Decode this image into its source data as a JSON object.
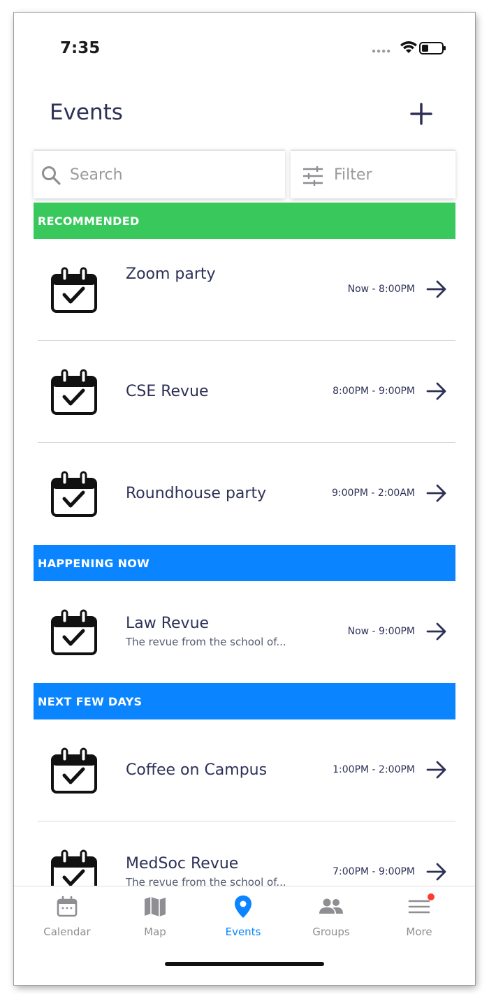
{
  "status_bar": {
    "time": "7:35"
  },
  "header": {
    "title": "Events"
  },
  "search": {
    "placeholder": "Search"
  },
  "filter": {
    "label": "Filter"
  },
  "sections": {
    "recommended": "RECOMMENDED",
    "happening_now": "HAPPENING NOW",
    "next_few_days": "NEXT FEW DAYS"
  },
  "events": {
    "zoom_party": {
      "title": "Zoom party",
      "time": "Now - 8:00PM"
    },
    "cse_revue": {
      "title": "CSE Revue",
      "time": "8:00PM - 9:00PM"
    },
    "roundhouse_party": {
      "title": "Roundhouse party",
      "time": "9:00PM - 2:00AM"
    },
    "law_revue": {
      "title": "Law Revue",
      "subtitle": "The revue from the school of...",
      "time": "Now - 9:00PM"
    },
    "coffee_on_campus": {
      "title": "Coffee on Campus",
      "time": "1:00PM - 2:00PM"
    },
    "medsoc_revue": {
      "title": "MedSoc Revue",
      "subtitle": "The revue from the school of...",
      "time": "7:00PM - 9:00PM"
    }
  },
  "tabs": {
    "calendar": "Calendar",
    "map": "Map",
    "events": "Events",
    "groups": "Groups",
    "more": "More"
  },
  "colors": {
    "recommended": "#38c85c",
    "section_blue": "#0a84ff",
    "accent": "#0a84ff",
    "text_dark": "#2e3157",
    "badge": "#ff3b30"
  },
  "icons": {
    "event": "calendar-check-icon",
    "row_action": "arrow-right-icon",
    "add": "plus-icon",
    "search": "search-icon",
    "filter": "sliders-icon"
  }
}
